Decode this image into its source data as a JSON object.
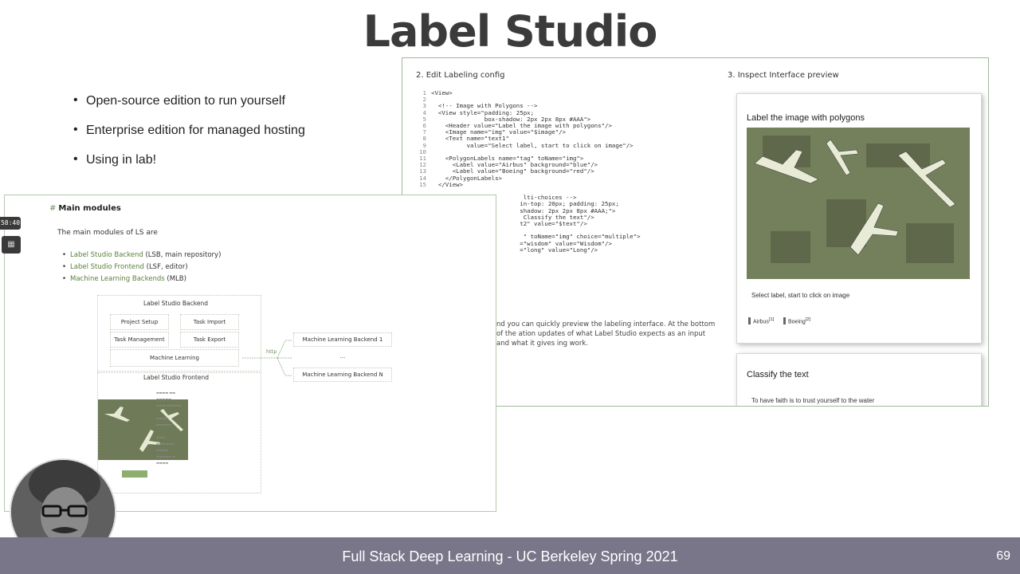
{
  "slide": {
    "title": "Label Studio",
    "bullets": [
      "Open-source edition to run yourself",
      "Enterprise edition for managed hosting",
      "Using in lab!"
    ],
    "footer": "Full Stack Deep Learning - UC Berkeley Spring 2021",
    "page_number": "69"
  },
  "right_shot": {
    "step2_label": "2. Edit Labeling config",
    "step3_label": "3. Inspect Interface preview",
    "code_lines": [
      {
        "n": "1",
        "t": "<View>"
      },
      {
        "n": "2",
        "t": ""
      },
      {
        "n": "3",
        "t": "  <!-- Image with Polygons -->"
      },
      {
        "n": "4",
        "t": "  <View style=\"padding: 25px;"
      },
      {
        "n": "5",
        "t": "               box-shadow: 2px 2px 8px #AAA\">"
      },
      {
        "n": "6",
        "t": "    <Header value=\"Label the image with polygons\"/>"
      },
      {
        "n": "7",
        "t": "    <Image name=\"img\" value=\"$image\"/>"
      },
      {
        "n": "8",
        "t": "    <Text name=\"text1\""
      },
      {
        "n": "9",
        "t": "          value=\"Select label, start to click on image\"/>"
      },
      {
        "n": "10",
        "t": ""
      },
      {
        "n": "11",
        "t": "    <PolygonLabels name=\"tag\" toName=\"img\">"
      },
      {
        "n": "12",
        "t": "      <Label value=\"Airbus\" background=\"blue\"/>"
      },
      {
        "n": "13",
        "t": "      <Label value=\"Boeing\" background=\"red\"/>"
      },
      {
        "n": "14",
        "t": "    </PolygonLabels>"
      },
      {
        "n": "15",
        "t": "  </View>"
      },
      {
        "n": "",
        "t": ""
      },
      {
        "n": "",
        "t": "                          lti-choices -->"
      },
      {
        "n": "",
        "t": "                         in-top: 20px; padding: 25px;"
      },
      {
        "n": "",
        "t": "                         shadow: 2px 2px 8px #AAA;\">"
      },
      {
        "n": "",
        "t": "                          Classify the text\"/>"
      },
      {
        "n": "",
        "t": "                         t2\" value=\"$text\"/>"
      },
      {
        "n": "",
        "t": ""
      },
      {
        "n": "",
        "t": "                          \" toName=\"img\" choice=\"multiple\">"
      },
      {
        "n": "",
        "t": "                         =\"wisdom\" value=\"Wisdom\"/>"
      },
      {
        "n": "",
        "t": "                         =\"long\" value=\"Long\"/>"
      }
    ],
    "description": "nd you can quickly preview the labeling interface. At the bottom of the ation updates of what Label Studio expects as an input and what it gives ing work.",
    "preview": {
      "header": "Label the image with polygons",
      "text": "Select label, start to click on image",
      "choices": [
        {
          "label": "Airbus",
          "sup": "[1]"
        },
        {
          "label": "Boeing",
          "sup": "[2]"
        }
      ],
      "header2": "Classify the text",
      "text2": "To have faith is to trust yourself to the water"
    }
  },
  "left_shot": {
    "heading_hash": "#",
    "heading": "Main modules",
    "intro": "The main modules of LS are",
    "modules": [
      {
        "link": "Label Studio Backend",
        "rest": " (LSB, main repository)"
      },
      {
        "link": "Label Studio Frontend",
        "rest": " (LSF, editor)"
      },
      {
        "link": "Machine Learning Backends",
        "rest": " (MLB)"
      }
    ],
    "diagram": {
      "backend_title": "Label Studio Backend",
      "project_setup": "Project Setup",
      "task_import": "Task Import",
      "task_management": "Task Management",
      "task_export": "Task Export",
      "machine_learning": "Machine Learning",
      "http": "http",
      "ml_backend_1": "Machine Learning Backend 1",
      "ml_backend_dots": "...",
      "ml_backend_n": "Machine Learning Backend N",
      "frontend_title": "Label Studio Frontend"
    }
  },
  "side": {
    "timer": "58:40"
  }
}
